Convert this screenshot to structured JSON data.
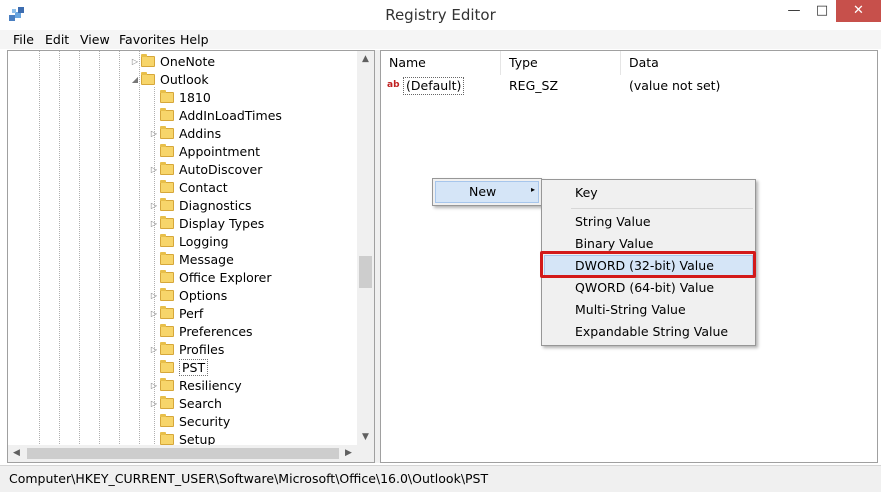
{
  "window": {
    "title": "Registry Editor",
    "minimize": "—",
    "maximize": "□",
    "close": "✕"
  },
  "menu": [
    "File",
    "Edit",
    "View",
    "Favorites",
    "Help"
  ],
  "tree": {
    "items": [
      {
        "label": "OneNote",
        "expander": "▷"
      },
      {
        "label": "Outlook",
        "expander": "◢"
      },
      {
        "label": "1810",
        "expander": ""
      },
      {
        "label": "AddInLoadTimes",
        "expander": ""
      },
      {
        "label": "Addins",
        "expander": "▷"
      },
      {
        "label": "Appointment",
        "expander": ""
      },
      {
        "label": "AutoDiscover",
        "expander": "▷"
      },
      {
        "label": "Contact",
        "expander": ""
      },
      {
        "label": "Diagnostics",
        "expander": "▷"
      },
      {
        "label": "Display Types",
        "expander": "▷"
      },
      {
        "label": "Logging",
        "expander": ""
      },
      {
        "label": "Message",
        "expander": ""
      },
      {
        "label": "Office Explorer",
        "expander": ""
      },
      {
        "label": "Options",
        "expander": "▷"
      },
      {
        "label": "Perf",
        "expander": "▷"
      },
      {
        "label": "Preferences",
        "expander": ""
      },
      {
        "label": "Profiles",
        "expander": "▷"
      },
      {
        "label": "PST",
        "expander": ""
      },
      {
        "label": "Resiliency",
        "expander": "▷"
      },
      {
        "label": "Search",
        "expander": "▷"
      },
      {
        "label": "Security",
        "expander": ""
      },
      {
        "label": "Setup",
        "expander": ""
      }
    ],
    "scroll_up": "▲",
    "scroll_down": "▼",
    "scroll_left": "◀",
    "scroll_right": "▶"
  },
  "list": {
    "columns": [
      "Name",
      "Type",
      "Data"
    ],
    "rows": [
      {
        "name": "(Default)",
        "type": "REG_SZ",
        "data": "(value not set)",
        "icon": "ab"
      }
    ]
  },
  "context_menu": {
    "new_label": "New",
    "submenu_arrow": "▸"
  },
  "submenu": {
    "key": "Key",
    "items": [
      "String Value",
      "Binary Value",
      "DWORD (32-bit) Value",
      "QWORD (64-bit) Value",
      "Multi-String Value",
      "Expandable String Value"
    ]
  },
  "status": {
    "path": "Computer\\HKEY_CURRENT_USER\\Software\\Microsoft\\Office\\16.0\\Outlook\\PST"
  },
  "colors": {
    "highlight_box": "#d31a1a",
    "menu_hover": "#d5e5f7",
    "close_button": "#c7504b"
  }
}
